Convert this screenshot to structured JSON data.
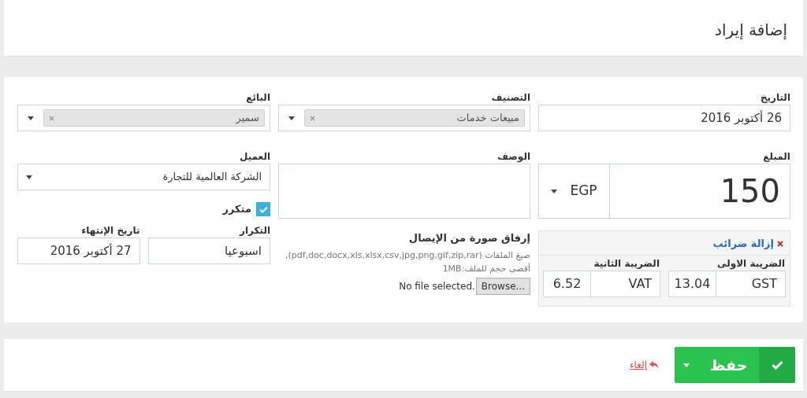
{
  "page_title": "إضافة إيراد",
  "date": {
    "label": "التاريخ",
    "value": "26 أكتوبر 2016"
  },
  "category": {
    "label": "التصنيف",
    "value": "مبيعات خدمات"
  },
  "vendor": {
    "label": "البائع",
    "value": "سمير"
  },
  "amount": {
    "label": "المبلغ",
    "value": "150",
    "currency": "EGP"
  },
  "description": {
    "label": "الوصف"
  },
  "client": {
    "label": "العميل",
    "value": "الشركة العالمية للتجارة"
  },
  "recurring": {
    "label": "متكرر",
    "checked": true
  },
  "repeat": {
    "label": "التكرار",
    "value": "اسبوعيا"
  },
  "end_date": {
    "label": "تاريخ الإنتهاء",
    "value": "27 أكتوبر 2016"
  },
  "attachment": {
    "label": "إرفاق صورة من الإيصال",
    "help": "صيغ الملفات (pdf,doc,docx,xls,xlsx,csv,jpg,png,gif,zip,rar), أقصى حجم للملف:1MB",
    "browse": "Browse...",
    "status": "No file selected."
  },
  "taxes": {
    "remove_label": "إزالة ضرائب",
    "items": [
      {
        "label": "الضريبة الاولى",
        "name": "GST",
        "amount": "13.04"
      },
      {
        "label": "الضريبة الثانية",
        "name": "VAT",
        "amount": "6.52"
      }
    ]
  },
  "actions": {
    "save": "حفظ",
    "cancel": "إلغاء"
  }
}
